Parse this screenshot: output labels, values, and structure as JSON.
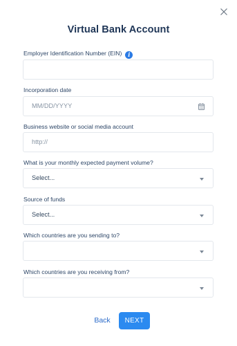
{
  "dialog": {
    "title": "Virtual Bank Account",
    "close_icon": "close-icon"
  },
  "fields": {
    "ein": {
      "label": "Employer Identification Number (EIN)",
      "info_icon": "info-icon",
      "info_glyph": "i",
      "value": ""
    },
    "incorporation_date": {
      "label": "Incorporation date",
      "placeholder": "MM/DD/YYYY",
      "icon": "calendar-icon"
    },
    "website": {
      "label": "Business website or social media account",
      "placeholder": "http://"
    },
    "payment_volume": {
      "label": "What is your monthly expected payment volume?",
      "selected": "Select..."
    },
    "source_of_funds": {
      "label": "Source of funds",
      "selected": "Select..."
    },
    "sending_to": {
      "label": "Which countries are you sending to?",
      "selected": ""
    },
    "receiving_from": {
      "label": "Which countries are you receiving from?",
      "selected": ""
    }
  },
  "actions": {
    "back_label": "Back",
    "next_label": "NEXT"
  },
  "colors": {
    "accent": "#2b8af0",
    "link": "#2b6bc9",
    "title": "#1e3556",
    "border": "#e3e7ec"
  }
}
